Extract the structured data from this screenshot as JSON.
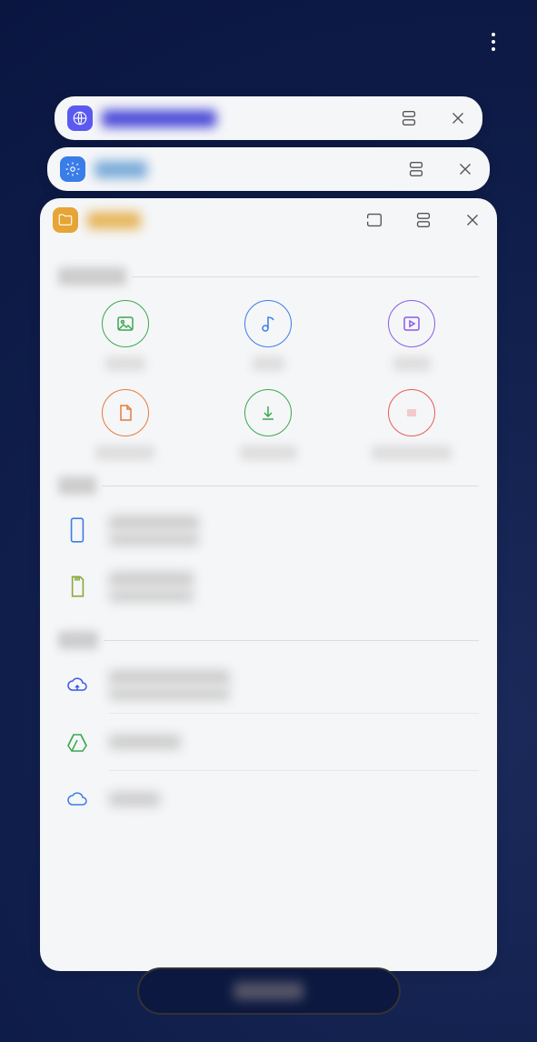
{
  "recentApps": [
    {
      "label": "Samsung Internet"
    },
    {
      "label": "Settings"
    },
    {
      "label": "My Files"
    }
  ],
  "sections": {
    "categories": "Categories",
    "local": "Local",
    "cloud": "Cloud"
  },
  "categories": [
    {
      "name": "Images",
      "color": "#3aa84f"
    },
    {
      "name": "Audio",
      "color": "#3a7de8"
    },
    {
      "name": "Videos",
      "color": "#8a5ae8"
    },
    {
      "name": "Documents",
      "color": "#e87a3a"
    },
    {
      "name": "Downloads",
      "color": "#3aa84f"
    },
    {
      "name": "Installation files",
      "color": "#e85a5a"
    }
  ],
  "storageLocal": [
    {
      "title": "Internal storage",
      "sub": "10.00 GB / 32.00 GB"
    },
    {
      "title": "SD card",
      "sub": "4.00 GB / 16.00 GB"
    }
  ],
  "storageCloud": [
    {
      "title": "Samsung Cloud Drive",
      "sub": "1.20 GB / 15.00 GB"
    },
    {
      "title": "Google Drive",
      "sub": ""
    },
    {
      "title": "OneDrive",
      "sub": ""
    }
  ],
  "closeAll": "CLOSE ALL"
}
